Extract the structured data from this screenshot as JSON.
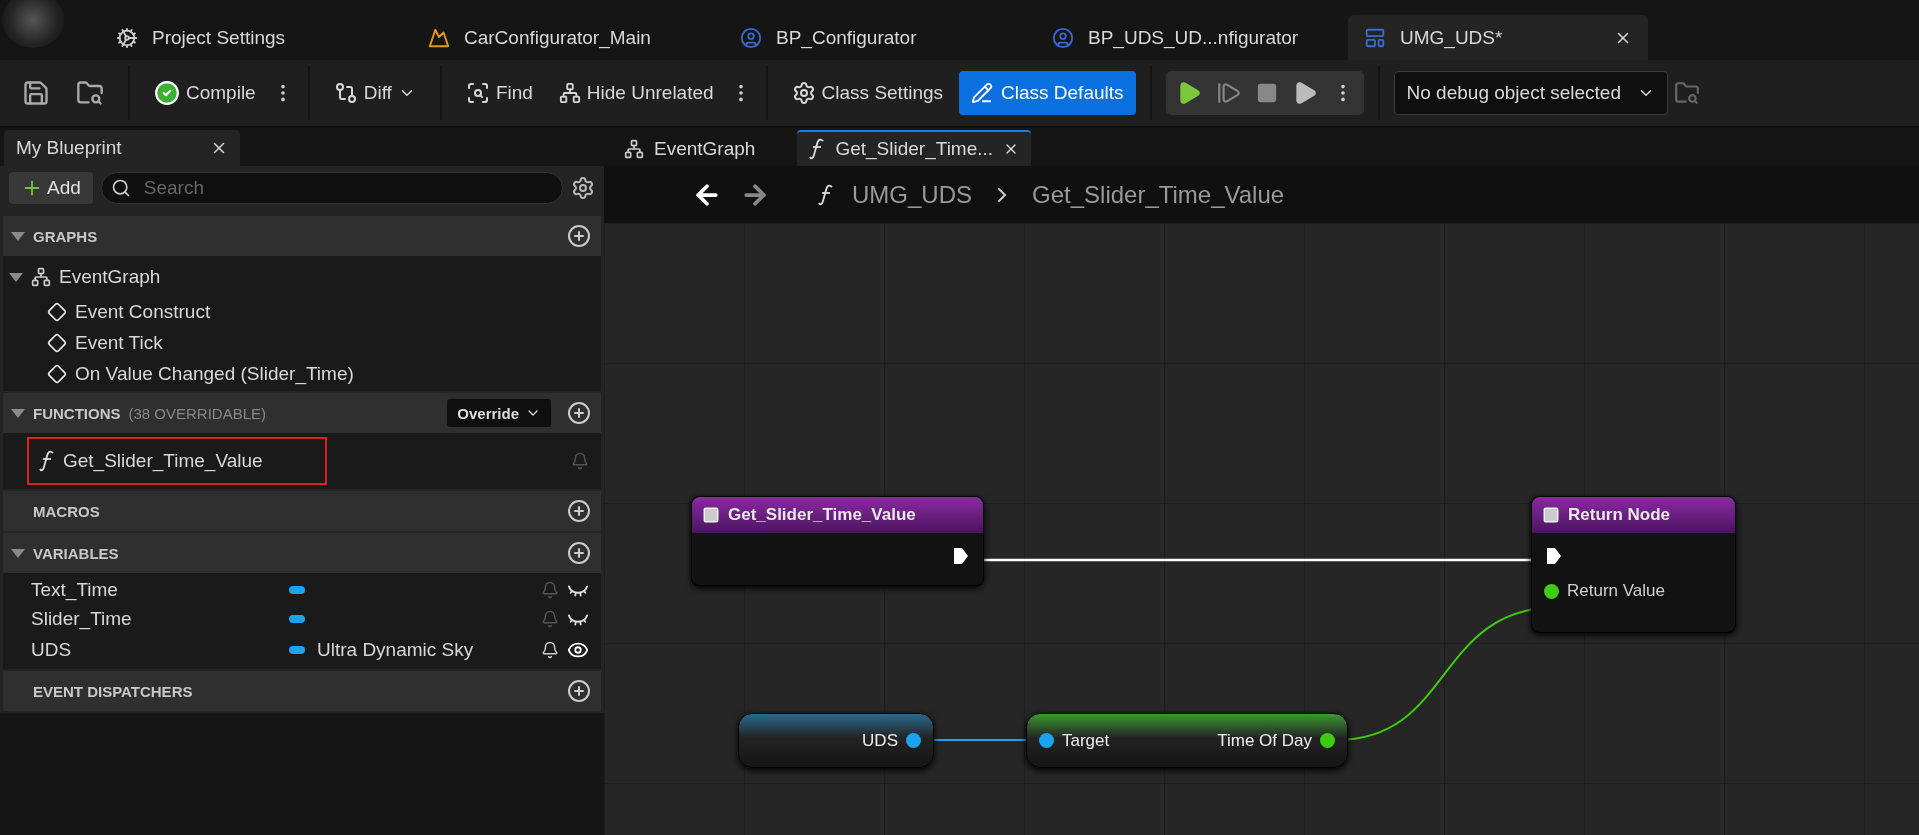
{
  "asset_tabs": [
    {
      "label": "Project Settings",
      "kind": "settings",
      "selected": false
    },
    {
      "label": "CarConfigurator_Main",
      "kind": "level",
      "selected": false
    },
    {
      "label": "BP_Configurator",
      "kind": "blueprint",
      "selected": false
    },
    {
      "label": "BP_UDS_UD...nfigurator",
      "kind": "blueprint",
      "selected": false
    },
    {
      "label": "UMG_UDS*",
      "kind": "widget",
      "selected": true
    }
  ],
  "toolbar": {
    "compile": "Compile",
    "diff": "Diff",
    "find": "Find",
    "hide_unrelated": "Hide Unrelated",
    "class_settings": "Class Settings",
    "class_defaults": "Class Defaults",
    "debug_object": "No debug object selected"
  },
  "my_blueprint": {
    "title": "My Blueprint",
    "add": "Add",
    "search_placeholder": "Search",
    "sections": [
      {
        "title": "GRAPHS",
        "expanded": true,
        "items": [
          {
            "label": "EventGraph",
            "kind": "graph",
            "children": [
              {
                "label": "Event Construct",
                "kind": "event"
              },
              {
                "label": "Event Tick",
                "kind": "event"
              },
              {
                "label": "On Value Changed (Slider_Time)",
                "kind": "event"
              }
            ]
          }
        ]
      },
      {
        "title": "FUNCTIONS",
        "note": "(38 OVERRIDABLE)",
        "override": "Override",
        "expanded": true,
        "items": [
          {
            "label": "Get_Slider_Time_Value",
            "kind": "function",
            "highlighted": true
          }
        ]
      },
      {
        "title": "MACROS"
      },
      {
        "title": "VARIABLES",
        "expanded": true,
        "items": [
          {
            "label": "Text_Time",
            "kind": "variable",
            "visible": false
          },
          {
            "label": "Slider_Time",
            "kind": "variable",
            "visible": false
          },
          {
            "label": "UDS",
            "kind": "variable",
            "type_name": "Ultra Dynamic Sky",
            "visible": true
          }
        ]
      },
      {
        "title": "EVENT DISPATCHERS"
      }
    ]
  },
  "graph_tabs": [
    {
      "label": "EventGraph",
      "kind": "graph",
      "selected": false
    },
    {
      "label": "Get_Slider_Time...",
      "kind": "function",
      "selected": true
    }
  ],
  "breadcrumb": [
    "UMG_UDS",
    "Get_Slider_Time_Value"
  ],
  "nodes": [
    {
      "kind": "function_entry",
      "title": "Get_Slider_Time_Value"
    },
    {
      "kind": "function_result",
      "title": "Return Node",
      "pin": "Return Value"
    },
    {
      "kind": "variable_get",
      "pin": "UDS"
    },
    {
      "kind": "pure_call",
      "input": "Target",
      "output": "Time Of Day"
    }
  ]
}
